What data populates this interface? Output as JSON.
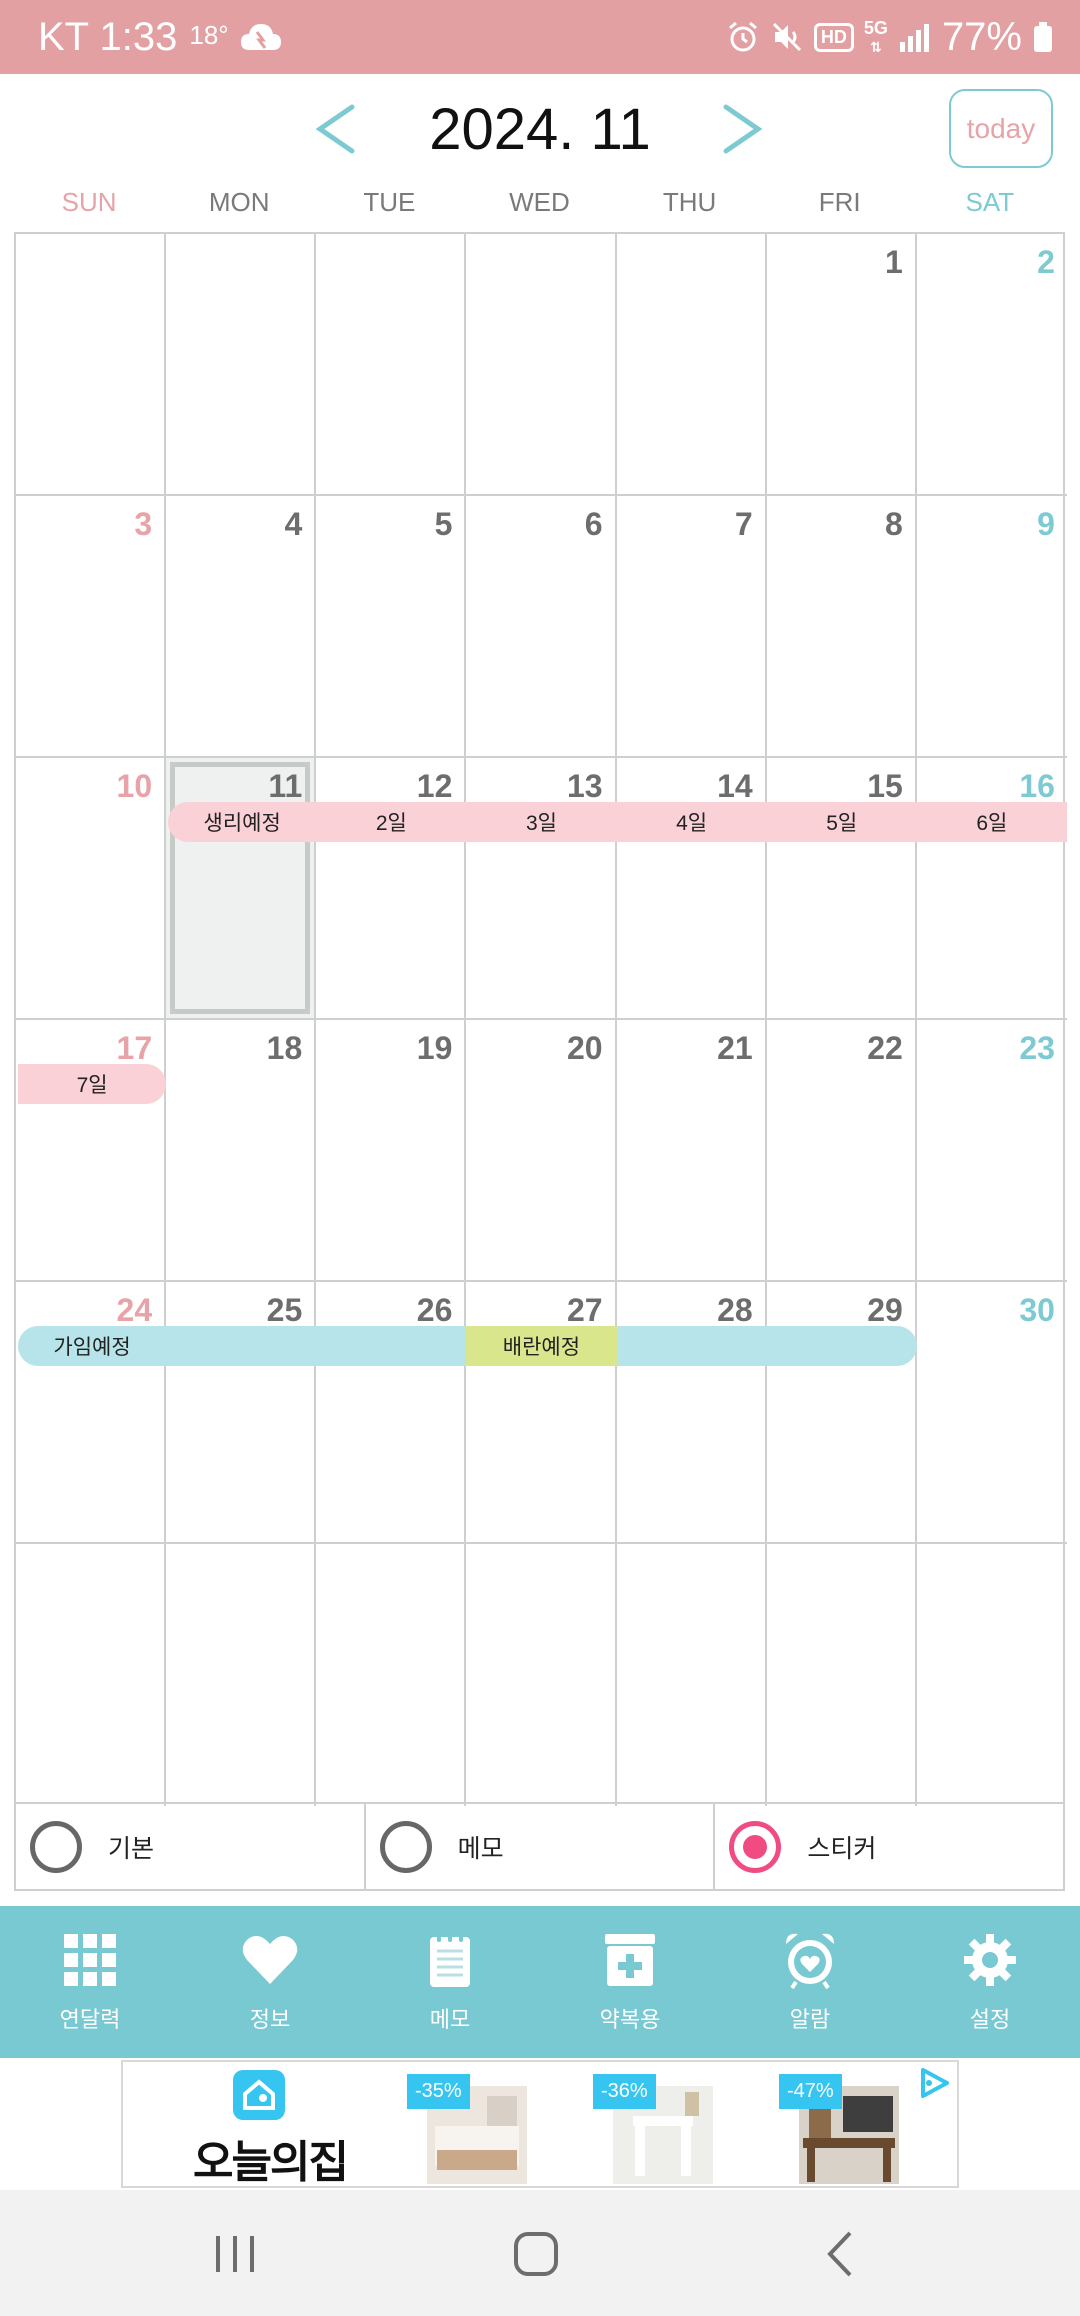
{
  "status_bar": {
    "carrier_time": "KT 1:33",
    "temperature": "18°",
    "hd_label": "HD",
    "fiveg_label": "5G",
    "battery": "77%"
  },
  "header": {
    "month_title": "2024. 11",
    "prev_label": "<",
    "next_label": ">",
    "today_label": "today"
  },
  "weekdays": [
    "SUN",
    "MON",
    "TUE",
    "WED",
    "THU",
    "FRI",
    "SAT"
  ],
  "calendar": {
    "weeks": [
      [
        "",
        "",
        "",
        "",
        "",
        "1",
        "2"
      ],
      [
        "3",
        "4",
        "5",
        "6",
        "7",
        "8",
        "9"
      ],
      [
        "10",
        "11",
        "12",
        "13",
        "14",
        "15",
        "16"
      ],
      [
        "17",
        "18",
        "19",
        "20",
        "21",
        "22",
        "23"
      ],
      [
        "24",
        "25",
        "26",
        "27",
        "28",
        "29",
        "30"
      ],
      [
        "",
        "",
        "",
        "",
        "",
        "",
        ""
      ]
    ],
    "selected_day": "11",
    "period_band": {
      "color": "#f9d1d6",
      "week1_labels": [
        "생리예정",
        "2일",
        "3일",
        "4일",
        "5일",
        "6일"
      ],
      "week2_labels": [
        "7일"
      ]
    },
    "fertile_band": {
      "color": "#b7e3ea",
      "ovulation_color": "#d9e68c",
      "labels": [
        "가임예정",
        "",
        "",
        "배란예정",
        "",
        ""
      ]
    }
  },
  "modes": [
    {
      "label": "기본",
      "selected": false
    },
    {
      "label": "메모",
      "selected": false
    },
    {
      "label": "스티커",
      "selected": true
    }
  ],
  "bottom_nav": [
    {
      "label": "연달력",
      "icon": "grid-icon"
    },
    {
      "label": "정보",
      "icon": "heart-icon"
    },
    {
      "label": "메모",
      "icon": "notepad-icon"
    },
    {
      "label": "약복용",
      "icon": "medicine-icon"
    },
    {
      "label": "알람",
      "icon": "alarm-clock-icon"
    },
    {
      "label": "설정",
      "icon": "gear-icon"
    }
  ],
  "ad": {
    "brand": "오늘의집",
    "discounts": [
      "-35%",
      "-36%",
      "-47%"
    ]
  },
  "colors": {
    "status_bar": "#e2a0a3",
    "accent_teal": "#79c9d3",
    "sunday": "#e7a3a7",
    "saturday": "#7dcad3",
    "radio_active": "#f04c82"
  }
}
